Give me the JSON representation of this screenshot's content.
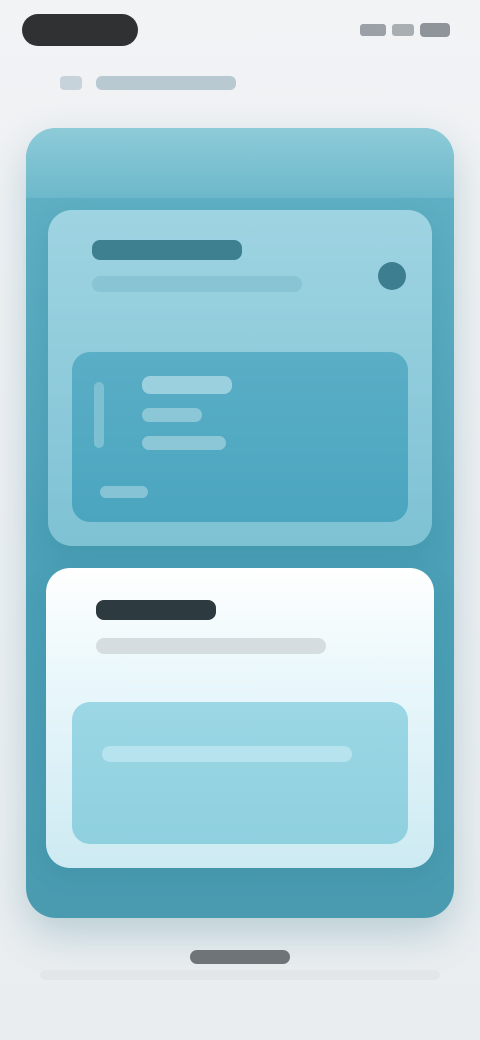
{
  "colors": {
    "background": "#eceff2",
    "outer_card": "#4a9fb6",
    "top_panel": "#9fd4e2",
    "top_inner": "#4ba5bf",
    "bottom_panel_top": "#ffffff",
    "bottom_inner": "#9bd7e5",
    "dark_text_block": "#2d3a3f",
    "status_pill": "#2f3133"
  },
  "icons": {
    "back": "chevron-left-icon",
    "close": "close-icon",
    "signal": "signal-icon",
    "wifi": "wifi-icon",
    "battery": "battery-icon"
  }
}
